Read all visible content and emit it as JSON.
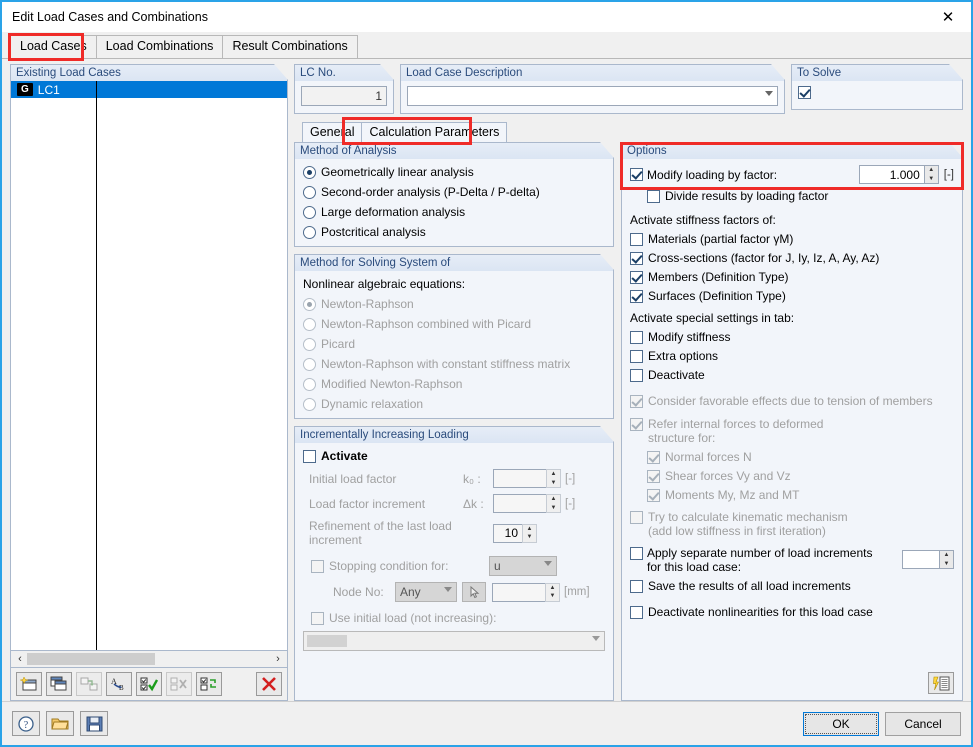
{
  "window": {
    "title": "Edit Load Cases and Combinations",
    "close_icon": "close-icon"
  },
  "tabs": [
    {
      "label": "Load Cases",
      "active": true
    },
    {
      "label": "Load Combinations",
      "active": false
    },
    {
      "label": "Result Combinations",
      "active": false
    }
  ],
  "left": {
    "group_title": "Existing Load Cases",
    "rows": [
      {
        "badge": "G",
        "name": "LC1"
      }
    ],
    "scroll": {
      "left_arrow": "‹",
      "right_arrow": "›"
    },
    "toolbar": [
      {
        "name": "new-load-case-button"
      },
      {
        "name": "copy-load-case-button"
      },
      {
        "name": "renumber-button"
      },
      {
        "name": "rename-button"
      },
      {
        "name": "select-all-button"
      },
      {
        "name": "deselect-all-button"
      },
      {
        "name": "invert-selection-button"
      },
      {
        "name": "delete-button"
      }
    ]
  },
  "header": {
    "lc_no_label": "LC No.",
    "lc_no_value": "1",
    "description_label": "Load Case Description",
    "description_value": "",
    "to_solve_label": "To Solve",
    "to_solve_checked": true
  },
  "inner_tabs": [
    {
      "label": "General",
      "active": false
    },
    {
      "label": "Calculation Parameters",
      "active": true
    }
  ],
  "method_of_analysis": {
    "title": "Method of Analysis",
    "options": [
      {
        "label": "Geometrically linear analysis",
        "checked": true,
        "disabled": false
      },
      {
        "label": "Second-order analysis (P-Delta / P-delta)",
        "checked": false,
        "disabled": false
      },
      {
        "label": "Large deformation analysis",
        "checked": false,
        "disabled": false
      },
      {
        "label": "Postcritical analysis",
        "checked": false,
        "disabled": false
      }
    ]
  },
  "solving_system": {
    "title": "Method for Solving System of",
    "subtitle": "Nonlinear algebraic equations:",
    "options": [
      {
        "label": "Newton-Raphson",
        "checked": true,
        "disabled": true
      },
      {
        "label": "Newton-Raphson combined with Picard",
        "checked": false,
        "disabled": true
      },
      {
        "label": "Picard",
        "checked": false,
        "disabled": true
      },
      {
        "label": "Newton-Raphson with constant stiffness matrix",
        "checked": false,
        "disabled": true
      },
      {
        "label": "Modified Newton-Raphson",
        "checked": false,
        "disabled": true
      },
      {
        "label": "Dynamic relaxation",
        "checked": false,
        "disabled": true
      }
    ]
  },
  "incremental": {
    "title": "Incrementally Increasing Loading",
    "activate_label": "Activate",
    "activate_checked": false,
    "initial_load_factor_label": "Initial load factor",
    "initial_load_factor_sym": "k₀ :",
    "initial_load_factor_value": "",
    "initial_load_factor_unit": "[-]",
    "load_factor_increment_label": "Load factor increment",
    "load_factor_increment_sym": "Δk :",
    "load_factor_increment_value": "",
    "load_factor_increment_unit": "[-]",
    "refinement_label": "Refinement of the last load increment",
    "refinement_value": "10",
    "stopping_label": "Stopping condition for:",
    "stopping_checked": false,
    "stopping_value": "u",
    "node_no_label": "Node No:",
    "node_no_value": "Any",
    "node_pick_icon": "pick-node-icon",
    "node_limit_value": "",
    "node_limit_unit": "[mm]",
    "use_initial_load_label": "Use initial load (not increasing):",
    "use_initial_load_checked": false,
    "initial_load_combo_value": ""
  },
  "options": {
    "title": "Options",
    "modify_loading_label": "Modify loading by factor:",
    "modify_loading_checked": true,
    "modify_loading_value": "1.000",
    "modify_loading_unit": "[-]",
    "divide_results_label": "Divide results by loading factor",
    "divide_results_checked": false,
    "stiffness_header": "Activate stiffness factors of:",
    "stiffness_items": [
      {
        "label": "Materials (partial factor γM)",
        "checked": false,
        "disabled": false
      },
      {
        "label": "Cross-sections (factor for J, Iy, Iz, A, Ay, Az)",
        "checked": true,
        "disabled": false
      },
      {
        "label": "Members (Definition Type)",
        "checked": true,
        "disabled": false
      },
      {
        "label": "Surfaces (Definition Type)",
        "checked": true,
        "disabled": false
      }
    ],
    "special_header": "Activate special settings in tab:",
    "special_items": [
      {
        "label": "Modify stiffness",
        "checked": false,
        "disabled": false
      },
      {
        "label": "Extra options",
        "checked": false,
        "disabled": false
      },
      {
        "label": "Deactivate",
        "checked": false,
        "disabled": false
      }
    ],
    "favorable_label": "Consider favorable effects due to tension of members",
    "favorable_checked": true,
    "refer_label_line1": "Refer internal forces to deformed",
    "refer_label_line2": "structure for:",
    "refer_checked": true,
    "refer_items": [
      {
        "label": "Normal forces N",
        "checked": true
      },
      {
        "label": "Shear forces Vy and Vz",
        "checked": true
      },
      {
        "label": "Moments My, Mz and MT",
        "checked": true
      }
    ],
    "kinematic_line1": "Try to calculate kinematic mechanism",
    "kinematic_line2": "(add low stiffness in first iteration)",
    "kinematic_checked": false,
    "apply_increments_line1": "Apply separate number of load increments",
    "apply_increments_line2": "for this load case:",
    "apply_increments_checked": false,
    "apply_increments_value": "",
    "save_results_label": "Save the results of all load increments",
    "save_results_checked": false,
    "deactivate_nonlin_label": "Deactivate nonlinearities for this load case",
    "deactivate_nonlin_checked": false,
    "settings_icon": "calculation-settings-icon"
  },
  "footer": {
    "help_icon": "help-icon",
    "open_icon": "open-folder-icon",
    "save_icon": "save-icon",
    "ok_label": "OK",
    "cancel_label": "Cancel"
  }
}
